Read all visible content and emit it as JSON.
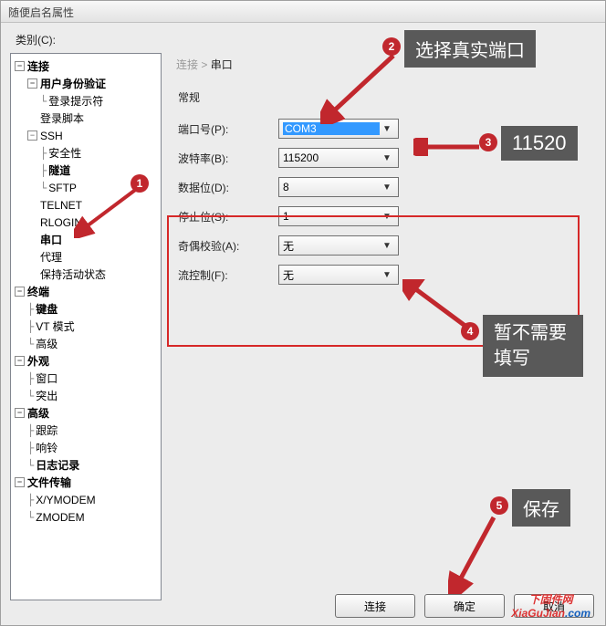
{
  "window": {
    "title": "随便启名属性"
  },
  "category_label": "类别(C):",
  "tree": {
    "connection": "连接",
    "auth": "用户身份验证",
    "prompt": "登录提示符",
    "script": "登录脚本",
    "ssh": "SSH",
    "security": "安全性",
    "tunnel": "隧道",
    "sftp": "SFTP",
    "telnet": "TELNET",
    "rlogin": "RLOGIN",
    "serial": "串口",
    "proxy": "代理",
    "keepalive": "保持活动状态",
    "terminal": "终端",
    "keyboard": "键盘",
    "vtmode": "VT 模式",
    "advanced_term": "高级",
    "appearance": "外观",
    "window": "窗口",
    "highlight": "突出",
    "advanced": "高级",
    "trace": "跟踪",
    "bell": "响铃",
    "logging": "日志记录",
    "filetransfer": "文件传输",
    "xymodem": "X/YMODEM",
    "zmodem": "ZMODEM"
  },
  "breadcrumb": {
    "parent": "连接",
    "sep": " > ",
    "current": "串口"
  },
  "section": {
    "general": "常规"
  },
  "fields": {
    "port": {
      "label": "端口号(P):",
      "value": "COM3"
    },
    "baud": {
      "label": "波特率(B):",
      "value": "115200"
    },
    "databits": {
      "label": "数据位(D):",
      "value": "8"
    },
    "stopbits": {
      "label": "停止位(S):",
      "value": "1"
    },
    "parity": {
      "label": "奇偶校验(A):",
      "value": "无"
    },
    "flow": {
      "label": "流控制(F):",
      "value": "无"
    }
  },
  "buttons": {
    "connect": "连接",
    "ok": "确定",
    "cancel": "取消"
  },
  "annotations": {
    "a1": {
      "num": "1"
    },
    "a2": {
      "num": "2",
      "text": "选择真实端口"
    },
    "a3": {
      "num": "3",
      "text": "11520"
    },
    "a4": {
      "num": "4",
      "text": "暂不需要填写"
    },
    "a5": {
      "num": "5",
      "text": "保存"
    }
  },
  "watermark": {
    "line1": "下固件网",
    "line2a": "XiaGuJian",
    "line2b": ".com"
  }
}
